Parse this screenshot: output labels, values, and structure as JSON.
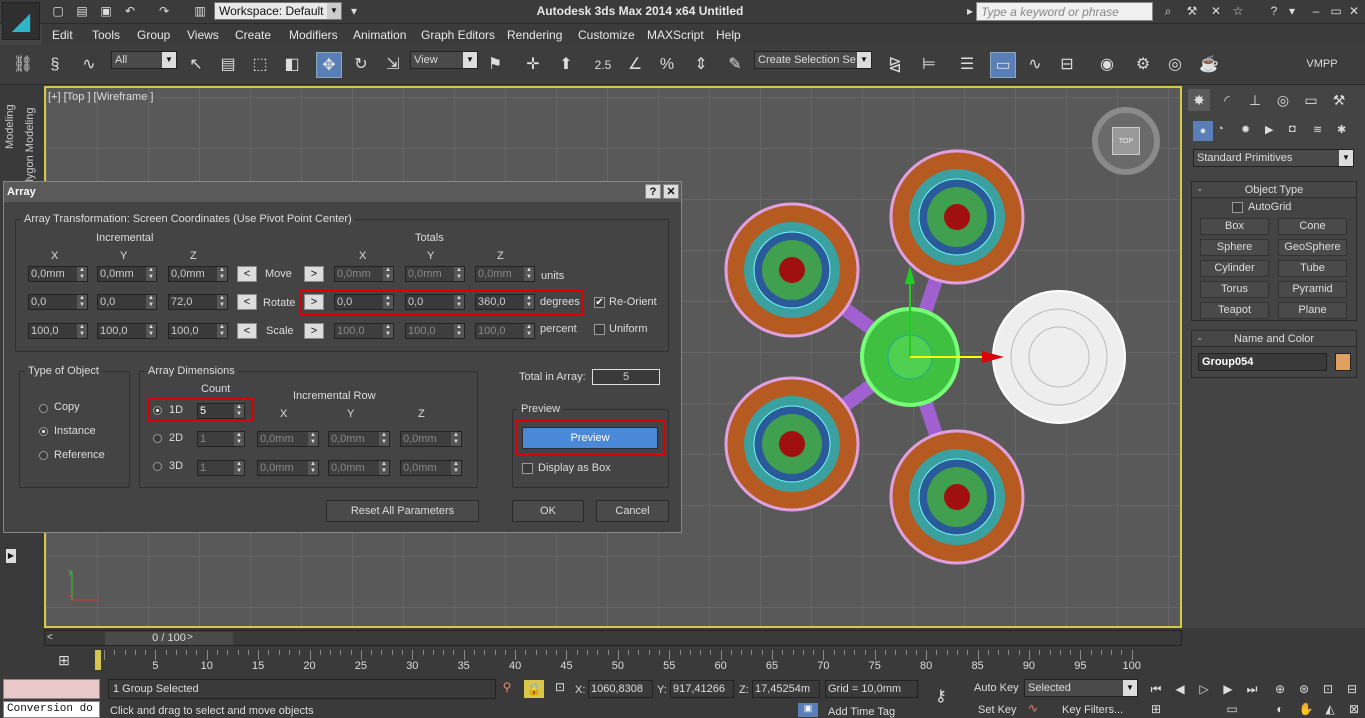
{
  "app": {
    "title": "Autodesk 3ds Max  2014 x64      Untitled",
    "workspace": "Workspace: Default",
    "search_placeholder": "Type a keyword or phrase"
  },
  "menu": [
    "Edit",
    "Tools",
    "Group",
    "Views",
    "Create",
    "Modifiers",
    "Animation",
    "Graph Editors",
    "Rendering",
    "Customize",
    "MAXScript",
    "Help"
  ],
  "toolbar": {
    "filter": "All",
    "refcoord": "View",
    "snap": "2.5",
    "selection_set": "Create Selection Se",
    "vmpp": "VMPP"
  },
  "left_tabs": [
    "Modeling",
    "Polygon Modeling"
  ],
  "viewport": {
    "label": "[+] [Top ] [Wireframe ]",
    "viewcube": "TOP"
  },
  "command_panel": {
    "category": "Standard Primitives",
    "object_type_title": "Object Type",
    "autogrid": "AutoGrid",
    "buttons": [
      "Box",
      "Cone",
      "Sphere",
      "GeoSphere",
      "Cylinder",
      "Tube",
      "Torus",
      "Pyramid",
      "Teapot",
      "Plane"
    ],
    "name_color_title": "Name and Color",
    "object_name": "Group054",
    "object_color": "#e0a060"
  },
  "dialog": {
    "title": "Array",
    "help": "?",
    "close": "✕",
    "transform_group": "Array Transformation: Screen Coordinates (Use Pivot Point Center)",
    "incremental": "Incremental",
    "totals": "Totals",
    "x": "X",
    "y": "Y",
    "z": "Z",
    "move": "Move",
    "rotate": "Rotate",
    "scale": "Scale",
    "units": "units",
    "degrees": "degrees",
    "percent": "percent",
    "reorient": "Re-Orient",
    "uniform": "Uniform",
    "inc_move": [
      "0,0mm",
      "0,0mm",
      "0,0mm"
    ],
    "inc_rotate": [
      "0,0",
      "0,0",
      "72,0"
    ],
    "inc_scale": [
      "100,0",
      "100,0",
      "100,0"
    ],
    "tot_move": [
      "0,0mm",
      "0,0mm",
      "0,0mm"
    ],
    "tot_rotate": [
      "0,0",
      "0,0",
      "360,0"
    ],
    "tot_scale": [
      "100,0",
      "100,0",
      "100,0"
    ],
    "type_group": "Type of Object",
    "copy": "Copy",
    "instance": "Instance",
    "reference": "Reference",
    "dim_group": "Array Dimensions",
    "count": "Count",
    "incremental_row": "Incremental Row",
    "d1": "1D",
    "d2": "2D",
    "d3": "3D",
    "count_1d": "5",
    "count_2d": "1",
    "count_3d": "1",
    "row_2d": [
      "0,0mm",
      "0,0mm",
      "0,0mm"
    ],
    "row_3d": [
      "0,0mm",
      "0,0mm",
      "0,0mm"
    ],
    "total_label": "Total in Array:",
    "total_value": "5",
    "preview_group": "Preview",
    "preview_btn": "Preview",
    "display_as_box": "Display as Box",
    "reset": "Reset All Parameters",
    "ok": "OK",
    "cancel": "Cancel"
  },
  "timeline": {
    "slider": "0 / 100",
    "ticks": [
      "5",
      "10",
      "15",
      "20",
      "25",
      "30",
      "35",
      "40",
      "45",
      "50",
      "55",
      "60",
      "65",
      "70",
      "75",
      "80",
      "85",
      "90",
      "95",
      "100"
    ]
  },
  "status": {
    "selected": "1 Group Selected",
    "prompt": "Click and drag to select and move objects",
    "x_label": "X:",
    "x": "1060,8308",
    "y_label": "Y:",
    "y": "917,41266",
    "z_label": "Z:",
    "z": "17,45254m",
    "grid": "Grid = 10,0mm",
    "autokey": "Auto Key",
    "setkey": "Set Key",
    "keymode": "Selected",
    "keyfilters": "Key Filters...",
    "addtimetag": "Add Time Tag",
    "conversion": "Conversion do"
  }
}
